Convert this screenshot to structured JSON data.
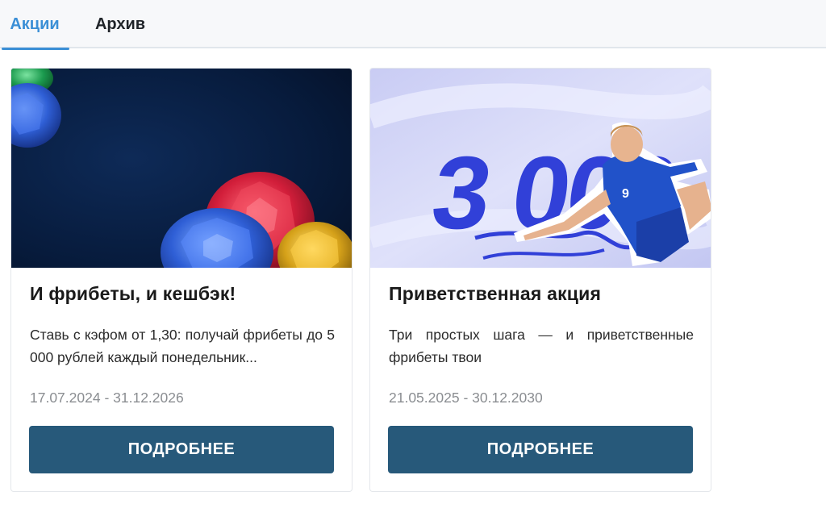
{
  "tabs": [
    {
      "label": "Акции",
      "active": true
    },
    {
      "label": "Архив",
      "active": false
    }
  ],
  "accent_color": "#3b8fd6",
  "button_color": "#27597a",
  "promos": [
    {
      "title": "И фрибеты, и кешбэк!",
      "description": "Ставь с кэфом от 1,30: получай фрибеты до 5 000 рублей каждый понедельник...",
      "dates": "17.07.2024 - 31.12.2026",
      "button_label": "ПОДРОБНЕЕ",
      "banner": "gemstones-banner"
    },
    {
      "title": "Приветственная акция",
      "description": "Три простых шага — и приветственные фрибеты твои",
      "dates": "21.05.2025 - 30.12.2030",
      "button_label": "ПОДРОБНЕЕ",
      "banner": "football-player-banner",
      "banner_text": "3 000 "
    }
  ]
}
